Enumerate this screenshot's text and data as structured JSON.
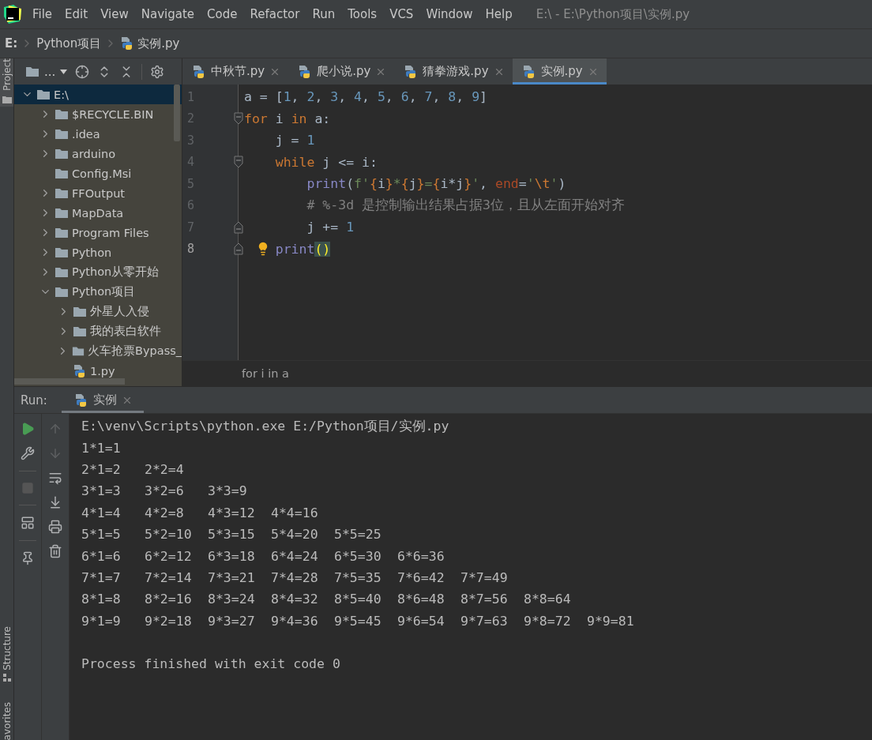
{
  "window": {
    "title": "E:\\ - E:\\Python项目\\实例.py"
  },
  "menu": [
    "File",
    "Edit",
    "View",
    "Navigate",
    "Code",
    "Refactor",
    "Run",
    "Tools",
    "VCS",
    "Window",
    "Help"
  ],
  "breadcrumb": [
    {
      "label": "E:",
      "kind": "drive"
    },
    {
      "label": "Python项目",
      "kind": "folder"
    },
    {
      "label": "实例.py",
      "kind": "file"
    }
  ],
  "side_labels": {
    "top": "Project",
    "bottom": [
      "Structure",
      "avorites"
    ]
  },
  "project_toolbar": {
    "label": "..."
  },
  "tree": [
    {
      "label": "E:\\",
      "kind": "folder",
      "expanded": true,
      "selected": true,
      "children": [
        {
          "label": "$RECYCLE.BIN",
          "kind": "folder",
          "expanded": false,
          "selected": false
        },
        {
          "label": ".idea",
          "kind": "folder",
          "expanded": false,
          "selected": false
        },
        {
          "label": "arduino",
          "kind": "folder",
          "expanded": false,
          "selected": false
        },
        {
          "label": "Config.Msi",
          "kind": "leaf-folder",
          "expanded": false,
          "selected": false
        },
        {
          "label": "FFOutput",
          "kind": "folder",
          "expanded": false,
          "selected": false
        },
        {
          "label": "MapData",
          "kind": "folder",
          "expanded": false,
          "selected": false
        },
        {
          "label": "Program Files",
          "kind": "folder",
          "expanded": false,
          "selected": false
        },
        {
          "label": "Python",
          "kind": "folder",
          "expanded": false,
          "selected": false
        },
        {
          "label": "Python从零开始",
          "kind": "folder",
          "expanded": false,
          "selected": false
        },
        {
          "label": "Python项目",
          "kind": "folder",
          "expanded": true,
          "selected": false,
          "children": [
            {
              "label": "外星人入侵",
              "kind": "folder",
              "expanded": false,
              "selected": false
            },
            {
              "label": "我的表白软件",
              "kind": "folder",
              "expanded": false,
              "selected": false
            },
            {
              "label": "火车抢票Bypass_",
              "kind": "folder",
              "expanded": false,
              "selected": false
            },
            {
              "label": "1.py",
              "kind": "file",
              "expanded": false,
              "selected": false
            }
          ]
        }
      ]
    }
  ],
  "tabs": [
    {
      "label": "中秋节.py",
      "selected": false
    },
    {
      "label": "爬小说.py",
      "selected": false
    },
    {
      "label": "猜拳游戏.py",
      "selected": false
    },
    {
      "label": "实例.py",
      "selected": true
    }
  ],
  "code": [
    {
      "number": "1",
      "fold_start": false,
      "fold_end": false,
      "current": false,
      "hint": false,
      "tokens": [
        {
          "kind": "plain",
          "text": "a = ["
        },
        {
          "kind": "number",
          "text": "1"
        },
        {
          "kind": "plain",
          "text": ", "
        },
        {
          "kind": "number",
          "text": "2"
        },
        {
          "kind": "plain",
          "text": ", "
        },
        {
          "kind": "number",
          "text": "3"
        },
        {
          "kind": "plain",
          "text": ", "
        },
        {
          "kind": "number",
          "text": "4"
        },
        {
          "kind": "plain",
          "text": ", "
        },
        {
          "kind": "number",
          "text": "5"
        },
        {
          "kind": "plain",
          "text": ", "
        },
        {
          "kind": "number",
          "text": "6"
        },
        {
          "kind": "plain",
          "text": ", "
        },
        {
          "kind": "number",
          "text": "7"
        },
        {
          "kind": "plain",
          "text": ", "
        },
        {
          "kind": "number",
          "text": "8"
        },
        {
          "kind": "plain",
          "text": ", "
        },
        {
          "kind": "number",
          "text": "9"
        },
        {
          "kind": "plain",
          "text": "]"
        }
      ]
    },
    {
      "number": "2",
      "fold_start": true,
      "fold_end": false,
      "current": false,
      "hint": false,
      "tokens": [
        {
          "kind": "keyword",
          "text": "for"
        },
        {
          "kind": "plain",
          "text": " i "
        },
        {
          "kind": "keyword",
          "text": "in"
        },
        {
          "kind": "plain",
          "text": " a:"
        }
      ]
    },
    {
      "number": "3",
      "fold_start": false,
      "fold_end": false,
      "current": false,
      "hint": false,
      "tokens": [
        {
          "kind": "plain",
          "text": "    j = "
        },
        {
          "kind": "number",
          "text": "1"
        }
      ]
    },
    {
      "number": "4",
      "fold_start": true,
      "fold_end": false,
      "current": false,
      "hint": false,
      "tokens": [
        {
          "kind": "keyword",
          "text": "    while"
        },
        {
          "kind": "plain",
          "text": " j <= i:"
        }
      ]
    },
    {
      "number": "5",
      "fold_start": false,
      "fold_end": false,
      "current": false,
      "hint": false,
      "tokens": [
        {
          "kind": "builtin",
          "text": "        print"
        },
        {
          "kind": "plain",
          "text": "("
        },
        {
          "kind": "string",
          "text": "f'"
        },
        {
          "kind": "brace",
          "text": "{"
        },
        {
          "kind": "plain",
          "text": "i"
        },
        {
          "kind": "brace",
          "text": "}"
        },
        {
          "kind": "string",
          "text": "*"
        },
        {
          "kind": "brace",
          "text": "{"
        },
        {
          "kind": "plain",
          "text": "j"
        },
        {
          "kind": "brace",
          "text": "}"
        },
        {
          "kind": "string",
          "text": "="
        },
        {
          "kind": "brace",
          "text": "{"
        },
        {
          "kind": "plain",
          "text": "i*j"
        },
        {
          "kind": "brace",
          "text": "}"
        },
        {
          "kind": "string",
          "text": "'"
        },
        {
          "kind": "plain",
          "text": ", "
        },
        {
          "kind": "param",
          "text": "end"
        },
        {
          "kind": "plain",
          "text": "="
        },
        {
          "kind": "string",
          "text": "'"
        },
        {
          "kind": "escape",
          "text": "\\t"
        },
        {
          "kind": "string",
          "text": "'"
        },
        {
          "kind": "plain",
          "text": ")"
        }
      ]
    },
    {
      "number": "6",
      "fold_start": false,
      "fold_end": false,
      "current": false,
      "hint": false,
      "tokens": [
        {
          "kind": "comment",
          "text": "        # %-3d 是控制输出结果占据3位，且从左面开始对齐"
        }
      ]
    },
    {
      "number": "7",
      "fold_start": false,
      "fold_end": true,
      "current": false,
      "hint": false,
      "tokens": [
        {
          "kind": "plain",
          "text": "        j += "
        },
        {
          "kind": "number",
          "text": "1"
        }
      ]
    },
    {
      "number": "8",
      "fold_start": false,
      "fold_end": true,
      "current": true,
      "hint": true,
      "tokens": [
        {
          "kind": "builtin",
          "text": "    print"
        },
        {
          "kind": "match",
          "text": "()"
        }
      ]
    }
  ],
  "editor_crumb": "for i in a",
  "run": {
    "label": "Run:",
    "tab": "实例"
  },
  "console": [
    {
      "kind": "command",
      "cells": [
        "E:\\venv\\Scripts\\python.exe E:/Python项目/实例.py"
      ]
    },
    {
      "kind": "output",
      "cells": [
        "1*1=1"
      ]
    },
    {
      "kind": "output",
      "cells": [
        "2*1=2",
        "2*2=4"
      ]
    },
    {
      "kind": "output",
      "cells": [
        "3*1=3",
        "3*2=6",
        "3*3=9"
      ]
    },
    {
      "kind": "output",
      "cells": [
        "4*1=4",
        "4*2=8",
        "4*3=12",
        "4*4=16"
      ]
    },
    {
      "kind": "output",
      "cells": [
        "5*1=5",
        "5*2=10",
        "5*3=15",
        "5*4=20",
        "5*5=25"
      ]
    },
    {
      "kind": "output",
      "cells": [
        "6*1=6",
        "6*2=12",
        "6*3=18",
        "6*4=24",
        "6*5=30",
        "6*6=36"
      ]
    },
    {
      "kind": "output",
      "cells": [
        "7*1=7",
        "7*2=14",
        "7*3=21",
        "7*4=28",
        "7*5=35",
        "7*6=42",
        "7*7=49"
      ]
    },
    {
      "kind": "output",
      "cells": [
        "8*1=8",
        "8*2=16",
        "8*3=24",
        "8*4=32",
        "8*5=40",
        "8*6=48",
        "8*7=56",
        "8*8=64"
      ]
    },
    {
      "kind": "output",
      "cells": [
        "9*1=9",
        "9*2=18",
        "9*3=27",
        "9*4=36",
        "9*5=45",
        "9*6=54",
        "9*7=63",
        "9*8=72",
        "9*9=81"
      ]
    },
    {
      "kind": "exit",
      "cells": [
        "Process finished with exit code 0"
      ]
    }
  ]
}
